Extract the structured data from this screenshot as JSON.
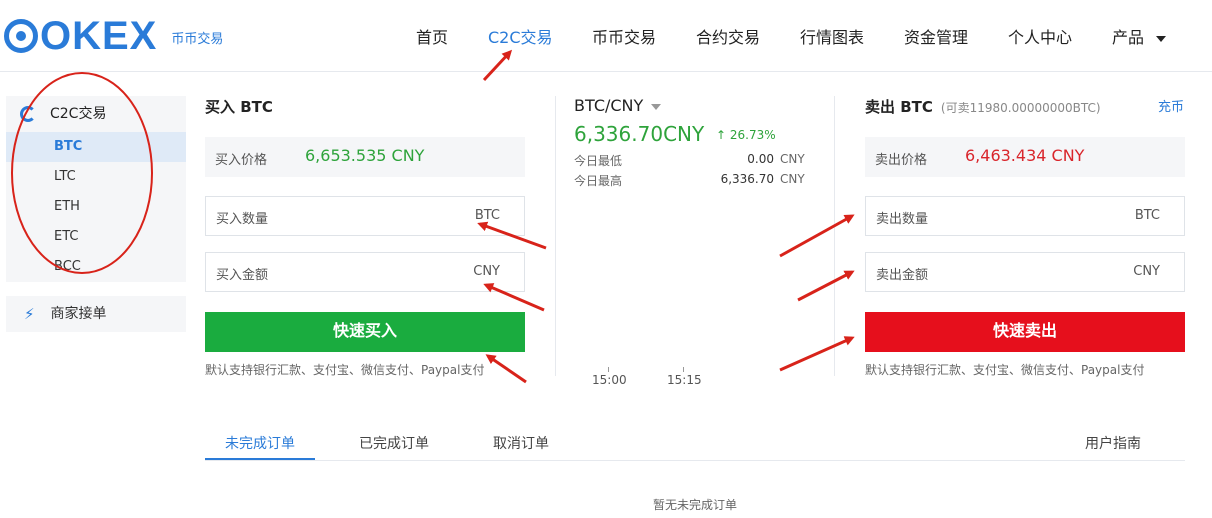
{
  "header": {
    "logo_text": "OKEX",
    "logo_sub": "币币交易",
    "nav": [
      {
        "label": "首页"
      },
      {
        "label": "C2C交易"
      },
      {
        "label": "币币交易"
      },
      {
        "label": "合约交易"
      },
      {
        "label": "行情图表"
      },
      {
        "label": "资金管理"
      },
      {
        "label": "个人中心"
      },
      {
        "label": "产品"
      }
    ],
    "active_nav": "C2C交易"
  },
  "sidebar": {
    "section_title": "C2C交易",
    "coins": [
      "BTC",
      "LTC",
      "ETH",
      "ETC",
      "BCC"
    ],
    "selected_coin": "BTC",
    "merchant_label": "商家接单"
  },
  "buy": {
    "title": "买入 BTC",
    "price_label": "买入价格",
    "price_value": "6,653.535 CNY",
    "amount_label": "买入数量",
    "amount_unit": "BTC",
    "total_label": "买入金额",
    "total_unit": "CNY",
    "button": "快速买入",
    "note": "默认支持银行汇款、支付宝、微信支付、Paypal支付"
  },
  "ticker": {
    "pair": "BTC/CNY",
    "last_price": "6,336.70CNY",
    "change": "↑ 26.73%",
    "low_label": "今日最低",
    "low_value": "0.00",
    "low_unit": "CNY",
    "high_label": "今日最高",
    "high_value": "6,336.70",
    "high_unit": "CNY",
    "x_ticks": [
      "15:00",
      "15:15"
    ]
  },
  "sell": {
    "title": "卖出 BTC",
    "available": "(可卖11980.00000000BTC)",
    "recharge": "充币",
    "price_label": "卖出价格",
    "price_value": "6,463.434 CNY",
    "amount_label": "卖出数量",
    "amount_unit": "BTC",
    "total_label": "卖出金额",
    "total_unit": "CNY",
    "button": "快速卖出",
    "note": "默认支持银行汇款、支付宝、微信支付、Paypal支付"
  },
  "orders": {
    "tabs": [
      "未完成订单",
      "已完成订单",
      "取消订单"
    ],
    "active_tab": "未完成订单",
    "guide": "用户指南",
    "empty": "暂无未完成订单"
  },
  "colors": {
    "brand_blue": "#2a7bd8",
    "buy_green": "#1aac3f",
    "sell_red": "#e60f1c",
    "annotation_red": "#d8231a"
  }
}
